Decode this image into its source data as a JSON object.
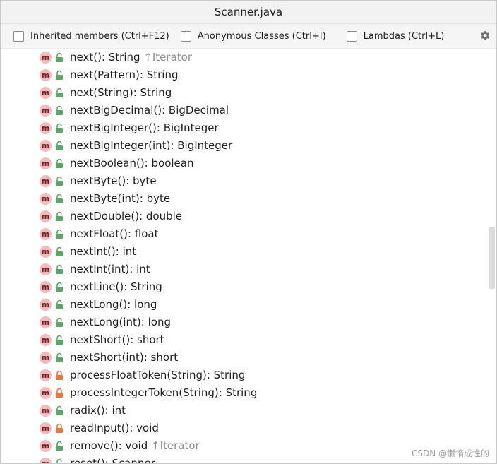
{
  "window": {
    "title": "Scanner.java"
  },
  "options": [
    {
      "label": "Inherited members (Ctrl+F12)",
      "checked": false
    },
    {
      "label": "Anonymous Classes (Ctrl+I)",
      "checked": false
    },
    {
      "label": "Lambdas (Ctrl+L)",
      "checked": false
    }
  ],
  "settings_icon": "gear-icon",
  "colors": {
    "method_badge": "#f3bcbc",
    "public_lock": "#59a869",
    "private_lock": "#e8783c",
    "inherited_text": "#8e8e8e"
  },
  "members": [
    {
      "badge": "m",
      "visibility": "public",
      "name": "next(): String",
      "inherited": "↑Iterator"
    },
    {
      "badge": "m",
      "visibility": "public",
      "name": "next(Pattern): String",
      "inherited": ""
    },
    {
      "badge": "m",
      "visibility": "public",
      "name": "next(String): String",
      "inherited": ""
    },
    {
      "badge": "m",
      "visibility": "public",
      "name": "nextBigDecimal(): BigDecimal",
      "inherited": ""
    },
    {
      "badge": "m",
      "visibility": "public",
      "name": "nextBigInteger(): BigInteger",
      "inherited": ""
    },
    {
      "badge": "m",
      "visibility": "public",
      "name": "nextBigInteger(int): BigInteger",
      "inherited": ""
    },
    {
      "badge": "m",
      "visibility": "public",
      "name": "nextBoolean(): boolean",
      "inherited": ""
    },
    {
      "badge": "m",
      "visibility": "public",
      "name": "nextByte(): byte",
      "inherited": ""
    },
    {
      "badge": "m",
      "visibility": "public",
      "name": "nextByte(int): byte",
      "inherited": ""
    },
    {
      "badge": "m",
      "visibility": "public",
      "name": "nextDouble(): double",
      "inherited": ""
    },
    {
      "badge": "m",
      "visibility": "public",
      "name": "nextFloat(): float",
      "inherited": ""
    },
    {
      "badge": "m",
      "visibility": "public",
      "name": "nextInt(): int",
      "inherited": ""
    },
    {
      "badge": "m",
      "visibility": "public",
      "name": "nextInt(int): int",
      "inherited": ""
    },
    {
      "badge": "m",
      "visibility": "public",
      "name": "nextLine(): String",
      "inherited": ""
    },
    {
      "badge": "m",
      "visibility": "public",
      "name": "nextLong(): long",
      "inherited": ""
    },
    {
      "badge": "m",
      "visibility": "public",
      "name": "nextLong(int): long",
      "inherited": ""
    },
    {
      "badge": "m",
      "visibility": "public",
      "name": "nextShort(): short",
      "inherited": ""
    },
    {
      "badge": "m",
      "visibility": "public",
      "name": "nextShort(int): short",
      "inherited": ""
    },
    {
      "badge": "m",
      "visibility": "private",
      "name": "processFloatToken(String): String",
      "inherited": ""
    },
    {
      "badge": "m",
      "visibility": "private",
      "name": "processIntegerToken(String): String",
      "inherited": ""
    },
    {
      "badge": "m",
      "visibility": "public",
      "name": "radix(): int",
      "inherited": ""
    },
    {
      "badge": "m",
      "visibility": "private",
      "name": "readInput(): void",
      "inherited": ""
    },
    {
      "badge": "m",
      "visibility": "public",
      "name": "remove(): void",
      "inherited": "↑Iterator"
    },
    {
      "badge": "m",
      "visibility": "public",
      "name": "reset(): Scanner",
      "inherited": ""
    }
  ],
  "watermark": "CSDN @懒惰成性的"
}
